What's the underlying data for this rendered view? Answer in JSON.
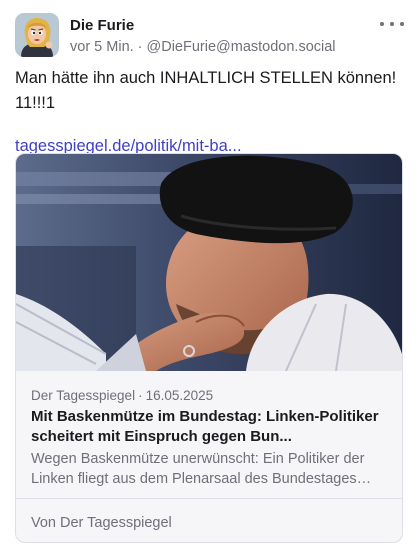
{
  "post": {
    "author": {
      "display_name": "Die Furie",
      "handle": "@DieFurie@mastodon.social",
      "avatar_icon": "cartoon-avatar"
    },
    "timestamp": "vor 5 Min.",
    "separator": "·",
    "more_icon": "ellipsis-icon",
    "text": "Man hätte ihn auch INHALTLICH STELLEN können! 11!!!1",
    "link_text": "tagesspiegel.de/politik/mit-ba..."
  },
  "link_card": {
    "image_description": "photo",
    "source": "Der Tagesspiegel",
    "date": "16.05.2025",
    "separator": "·",
    "title": "Mit Baskenmütze im Bundestag: Linken-Politiker scheitert mit Einspruch gegen Bun...",
    "description": "Wegen Baskenmütze unerwünscht: Ein Politiker der Linken fliegt aus dem Plenarsaal des Bundestages un...",
    "footer_prefix": "Von",
    "footer_source": "Der Tagesspiegel"
  },
  "colors": {
    "link": "#3f3fc7",
    "muted_text": "#6f6f78",
    "card_background": "#f6f6f9",
    "border": "#dedee6"
  }
}
